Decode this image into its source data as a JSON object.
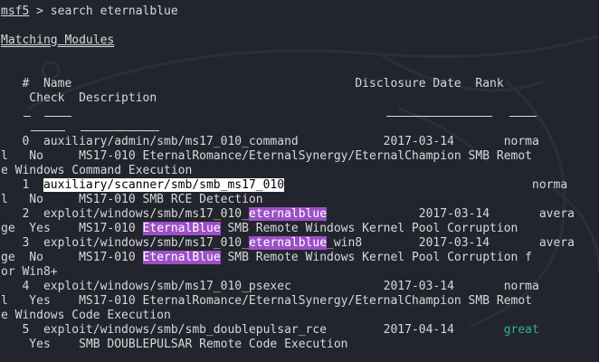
{
  "prompt": {
    "host": "msf5",
    "separator": " > ",
    "command": "search eternalblue"
  },
  "section_title": "Matching Modules",
  "header": {
    "line1": "   #  Name                                        Disclosure Date  Rank",
    "line2": "    Check  Description"
  },
  "rows": [
    {
      "lines": [
        [
          {
            "t": "   0  auxiliary/admin/smb/ms17_010_command            2017-03-14       norma"
          }
        ],
        [
          {
            "t": "l   No     MS17-010 EternalRomance/EternalSynergy/EternalChampion SMB Remot"
          }
        ],
        [
          {
            "t": "e Windows Command Execution"
          }
        ]
      ]
    },
    {
      "lines": [
        [
          {
            "t": "   1  "
          },
          {
            "t": "auxiliary/scanner/smb/smb_ms17_010",
            "c": "hl-white"
          },
          {
            "t": "                                   norma"
          }
        ],
        [
          {
            "t": "l   No     MS17-010 SMB RCE Detection"
          }
        ]
      ]
    },
    {
      "lines": [
        [
          {
            "t": "   2  exploit/windows/smb/ms17_010_"
          },
          {
            "t": "eternalblue",
            "c": "hl-purple"
          },
          {
            "t": "             2017-03-14       avera"
          }
        ],
        [
          {
            "t": "ge  Yes    MS17-010 "
          },
          {
            "t": "EternalBlue",
            "c": "hl-purple"
          },
          {
            "t": " SMB Remote Windows Kernel Pool Corruption"
          }
        ]
      ]
    },
    {
      "lines": [
        [
          {
            "t": "   3  exploit/windows/smb/ms17_010_"
          },
          {
            "t": "eternalblue",
            "c": "hl-purple"
          },
          {
            "t": "_win8        2017-03-14       avera"
          }
        ],
        [
          {
            "t": "ge  No     MS17-010 "
          },
          {
            "t": "EternalBlue",
            "c": "hl-purple"
          },
          {
            "t": " SMB Remote Windows Kernel Pool Corruption f"
          }
        ],
        [
          {
            "t": "or Win8+"
          }
        ]
      ]
    },
    {
      "lines": [
        [
          {
            "t": "   4  exploit/windows/smb/ms17_010_psexec             2017-03-14       norma"
          }
        ],
        [
          {
            "t": "l   Yes    MS17-010 EternalRomance/EternalSynergy/EternalChampion SMB Remot"
          }
        ],
        [
          {
            "t": "e Windows Code Execution"
          }
        ]
      ]
    },
    {
      "lines": [
        [
          {
            "t": "   5  exploit/windows/smb/smb_doublepulsar_rce        2017-04-14       "
          },
          {
            "t": "great",
            "c": "great"
          }
        ],
        [
          {
            "t": "    Yes    SMB DOUBLEPULSAR Remote Code Execution"
          }
        ]
      ]
    }
  ]
}
